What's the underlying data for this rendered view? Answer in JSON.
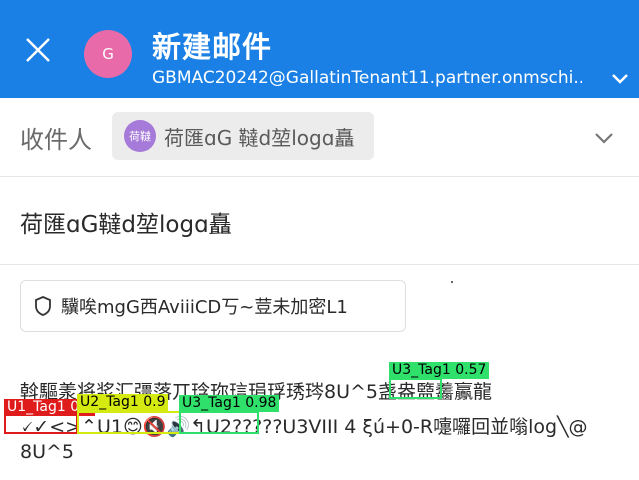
{
  "header": {
    "title": "新建邮件",
    "account": "GBMAC20242@GallatinTenant11.partner.onmschi...",
    "avatar_letter": "G",
    "avatar_color": "#e86aa9",
    "background": "#1a80e5"
  },
  "to_field": {
    "label": "收件人",
    "chip_avatar": "荷韃",
    "chip_name": "荷匯ɑ󠁎G 韃d堃lᴏgɑ矗",
    "chip_avatar_color": "#a57ad9"
  },
  "subject": {
    "text": "荷匯ɑ󠁎G韃d堃lᴏgɑ矗"
  },
  "encryption": {
    "label": "驥唉mgG西AviiiC󠁎D丂~荳未加密L1"
  },
  "body": {
    "line1": "斡驅羕将浆汇彊落丌琀珎琂琄琈琇琌8U^5盏盎盬齹鸁龍",
    "line2": "🗸✓<>⌃U1😊🔇🔊↰U2?????U3VIII 4 ξú+0-R嚏囉回並嗡lᴏg╲@",
    "line3": "8U^5"
  },
  "annotations": [
    {
      "label": "U1_Tag1 0.9",
      "color": "#e01b1b",
      "text_color": "#ffffff"
    },
    {
      "label": "U2_Tag1 0.9",
      "color": "#d4ea10",
      "text_color": "#000000"
    },
    {
      "label": "U3_Tag1 0.98",
      "color": "#2fe06b",
      "text_color": "#000000"
    },
    {
      "label": "U3_Tag1 0.57",
      "color": "#2fe06b",
      "text_color": "#000000"
    }
  ]
}
